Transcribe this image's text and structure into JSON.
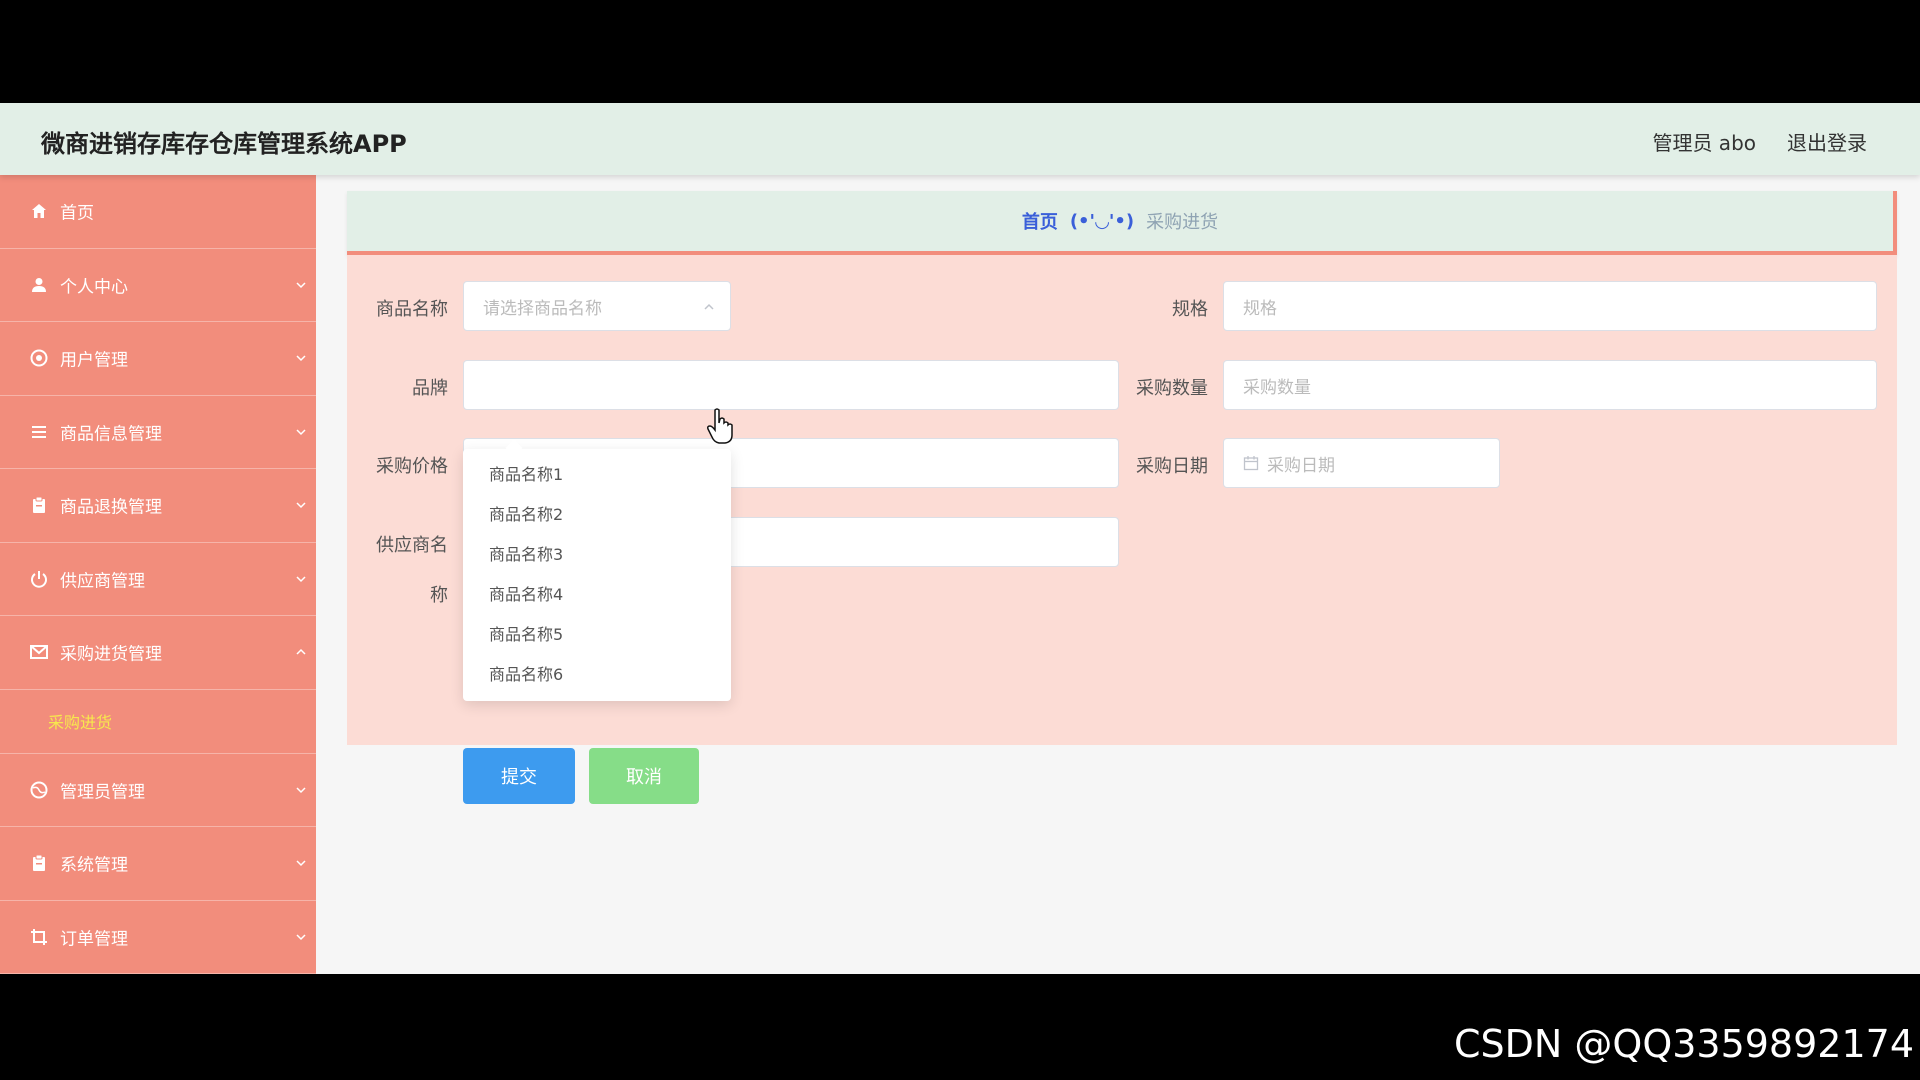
{
  "header": {
    "title": "微商进销存库存仓库管理系统APP",
    "admin_label": "管理员 abo",
    "logout_label": "退出登录"
  },
  "sidebar": {
    "items": [
      {
        "label": "首页",
        "icon": "home-icon"
      },
      {
        "label": "个人中心",
        "icon": "user-icon"
      },
      {
        "label": "用户管理",
        "icon": "settings-icon"
      },
      {
        "label": "商品信息管理",
        "icon": "list-icon"
      },
      {
        "label": "商品退换管理",
        "icon": "clipboard-icon"
      },
      {
        "label": "供应商管理",
        "icon": "power-icon"
      },
      {
        "label": "采购进货管理",
        "icon": "mail-icon"
      },
      {
        "label": "管理员管理",
        "icon": "globe-icon"
      },
      {
        "label": "系统管理",
        "icon": "clipboard-icon"
      },
      {
        "label": "订单管理",
        "icon": "crop-icon"
      }
    ],
    "active_subitem": "采购进货",
    "accent_color": "#f28d7c",
    "active_color": "#f7e84d"
  },
  "breadcrumb": {
    "home": "首页",
    "separator": "(•'◡'•)",
    "current": "采购进货"
  },
  "form": {
    "product_name": {
      "label": "商品名称",
      "placeholder": "请选择商品名称"
    },
    "spec": {
      "label": "规格",
      "placeholder": "规格"
    },
    "brand": {
      "label": "品牌",
      "placeholder": ""
    },
    "quantity": {
      "label": "采购数量",
      "placeholder": "采购数量"
    },
    "price": {
      "label": "采购价格",
      "placeholder": ""
    },
    "date": {
      "label": "采购日期",
      "placeholder": "采购日期"
    },
    "supplier": {
      "label_line1": "供应商名",
      "label_line2": "称",
      "placeholder": ""
    },
    "submit_label": "提交",
    "cancel_label": "取消"
  },
  "dropdown": {
    "options": [
      "商品名称1",
      "商品名称2",
      "商品名称3",
      "商品名称4",
      "商品名称5",
      "商品名称6"
    ]
  },
  "watermark": "CSDN @QQ3359892174"
}
